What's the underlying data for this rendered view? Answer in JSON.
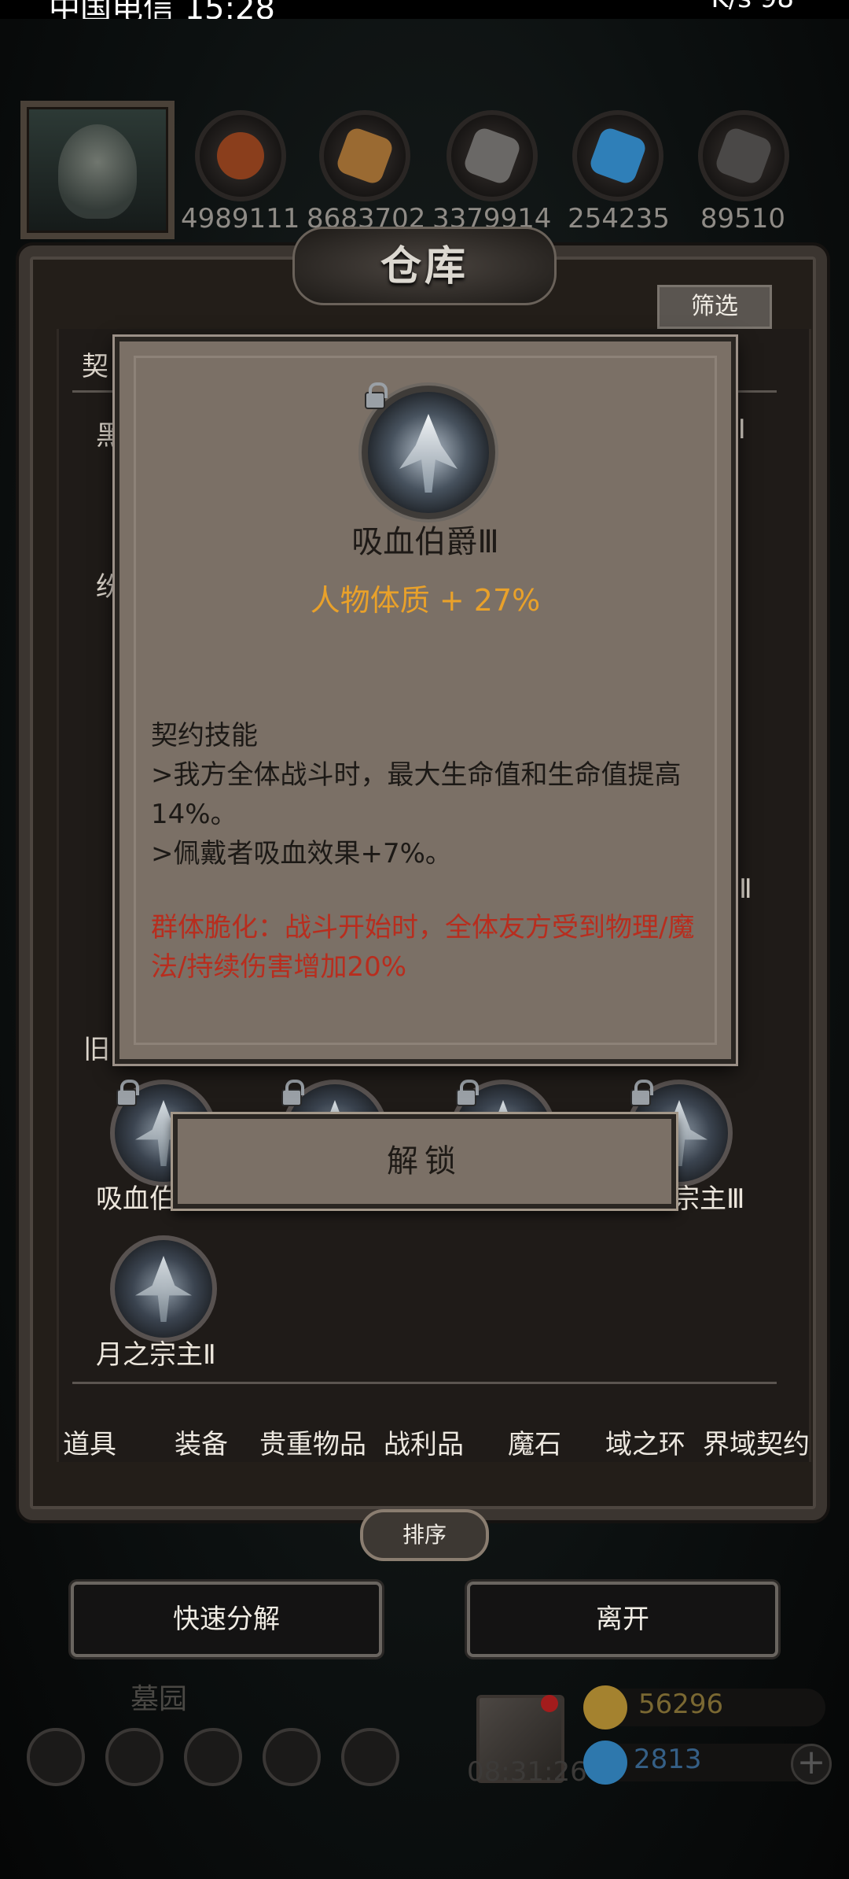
{
  "statusbar": {
    "left": "中国电信 15:28",
    "right": "K/s 98"
  },
  "resources": [
    "4989111",
    "8683702",
    "3379914",
    "254235",
    "89510"
  ],
  "warehouse": {
    "title": "仓库",
    "filter_label": "筛选"
  },
  "peek_labels": {
    "top_left": "契",
    "row1": "黑",
    "row2": "纷",
    "bottom_left": "旧",
    "right_roman1": "Ⅱ",
    "right_roman2": "Ⅱ"
  },
  "items": [
    {
      "label": "吸血伯"
    },
    {
      "label": ""
    },
    {
      "label": ""
    },
    {
      "label": "宗主Ⅲ"
    },
    {
      "label": "月之宗主Ⅱ"
    }
  ],
  "categories": [
    "道具",
    "装备",
    "贵重物品",
    "战利品",
    "魔石",
    "域之环",
    "界域契约"
  ],
  "sort_label": "排序",
  "buttons": {
    "decompose": "快速分解",
    "leave": "离开"
  },
  "bottom": {
    "area_name": "墓园",
    "timer": "08:31:26",
    "gold": "56296",
    "gems": "2813"
  },
  "popup": {
    "name": "吸血伯爵Ⅲ",
    "stat": "人物体质 + 27%",
    "skill_title": "契约技能",
    "skill_line1": ">我方全体战斗时，最大生命值和生命值提高14%。",
    "skill_line2": ">佩戴者吸血效果+7%。",
    "special": "群体脆化：战斗开始时，全体友方受到物理/魔法/持续伤害增加20%",
    "unlock_label": "解锁"
  },
  "colors": {
    "stat_orange": "#e9a12a",
    "special_red": "#b82d1e",
    "popup_bg": "#7b7066"
  }
}
